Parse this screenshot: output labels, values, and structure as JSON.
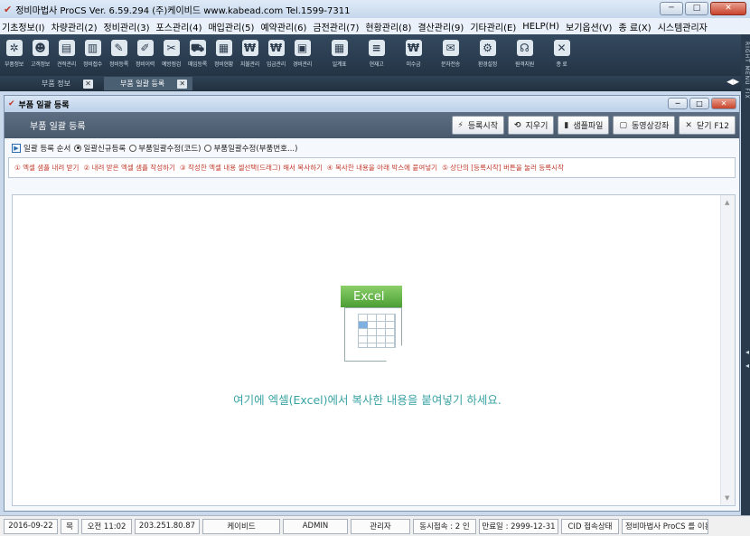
{
  "window": {
    "title": "정비마법사 ProCS  Ver. 6.59.294  (주)케이비드  www.kabead.com  Tel.1599-7311",
    "controls": {
      "minimize": "─",
      "maximize": "□",
      "close": "✕"
    }
  },
  "menu": [
    "기초정보(I)",
    "차량관리(2)",
    "정비관리(3)",
    "포스관리(4)",
    "매입관리(5)",
    "예약관리(6)",
    "금전관리(7)",
    "현황관리(8)",
    "결산관리(9)",
    "기타관리(E)",
    "HELP(H)",
    "보기옵션(V)",
    "종 료(X)",
    "시스템관리자"
  ],
  "toolbar": [
    {
      "label": "부품정보",
      "icon": "gear-icon",
      "glyph": "✲"
    },
    {
      "label": "고객정보",
      "icon": "customers-icon",
      "glyph": "☻"
    },
    {
      "label": "견적관리",
      "icon": "document-icon",
      "glyph": "▤"
    },
    {
      "label": "정비접수",
      "icon": "receipt-icon",
      "glyph": "▥"
    },
    {
      "label": "정비등록",
      "icon": "wrench-icon",
      "glyph": "✎"
    },
    {
      "label": "정비이력",
      "icon": "history-icon",
      "glyph": "✐"
    },
    {
      "label": "예방점검",
      "icon": "tools-icon",
      "glyph": "✂"
    },
    {
      "label": "매입등록",
      "icon": "truck-icon",
      "glyph": "⛟"
    },
    {
      "label": "정비현황",
      "icon": "chart-icon",
      "glyph": "▦"
    },
    {
      "label": "지불관리",
      "icon": "payment-icon",
      "glyph": "₩"
    },
    {
      "label": "입금관리",
      "icon": "deposit-icon",
      "glyph": "₩"
    },
    {
      "label": "경비관리",
      "icon": "calculator-icon",
      "glyph": "▣"
    },
    {
      "label": "일계표",
      "icon": "calendar-icon",
      "glyph": "▦"
    },
    {
      "label": "현재고",
      "icon": "stock-icon",
      "glyph": "≡"
    },
    {
      "label": "미수금",
      "icon": "receivable-icon",
      "glyph": "₩"
    },
    {
      "label": "문자전송",
      "icon": "sms-icon",
      "glyph": "✉"
    },
    {
      "label": "환경설정",
      "icon": "settings-icon",
      "glyph": "⚙"
    },
    {
      "label": "원격지원",
      "icon": "headset-icon",
      "glyph": "☊"
    },
    {
      "label": "종 료",
      "icon": "exit-icon",
      "glyph": "✕"
    }
  ],
  "tabs": [
    {
      "label": "부품 정보",
      "close": "✕",
      "active": false
    },
    {
      "label": "부품 일괄 등록",
      "close": "✕",
      "active": true
    }
  ],
  "tab_nav": "◀▶",
  "right_strip": "RIGHT MENU FIX",
  "child_window": {
    "title": "부품 일괄 등록",
    "header": "부품 일괄 등록",
    "buttons": [
      {
        "label": "등록시작",
        "glyph": "⚡"
      },
      {
        "label": "지우기",
        "glyph": "⟲"
      },
      {
        "label": "샘플파일",
        "glyph": "▮"
      },
      {
        "label": "동영상강좌",
        "glyph": "▢"
      },
      {
        "label": "닫기 F12",
        "glyph": "✕"
      }
    ],
    "order_label": "일괄 등록 순서",
    "radio_options": [
      {
        "label": "일괄신규등록",
        "checked": true
      },
      {
        "label": "부품일괄수정(코드)",
        "checked": false
      },
      {
        "label": "부품일괄수정(부품번호...)",
        "checked": false
      }
    ],
    "steps": [
      "① 엑셀 샘플 내려 받기",
      "② 내려 받은 엑셀 샘플 작성하기",
      "③ 작성한 엑셀 내용 셀선택(드래그) 해서 복사하기",
      "④ 복사한 내용을 아래 박스에 붙여넣기",
      "⑤ 상단의 [등록시작] 버튼을 눌러 등록시작"
    ],
    "excel_label": "Excel",
    "paste_message": "여기에 엑셀(Excel)에서 복사한 내용을 붙여넣기 하세요."
  },
  "status_bar": [
    "2016-09-22",
    "목",
    "오전 11:02",
    "203.251.80.87",
    "케이비드",
    "ADMIN",
    "관리자",
    "동시접속 : 2 인",
    "만료일 : 2999-12-31",
    "CID 접속상태",
    "정비마법사 ProCS 를 이용해 주"
  ],
  "colors": {
    "toolbar_bg": "#2b3d51",
    "steps_text": "#c0392b",
    "paste_text": "#3aa3a3",
    "excel_green": "#4a9e34"
  }
}
